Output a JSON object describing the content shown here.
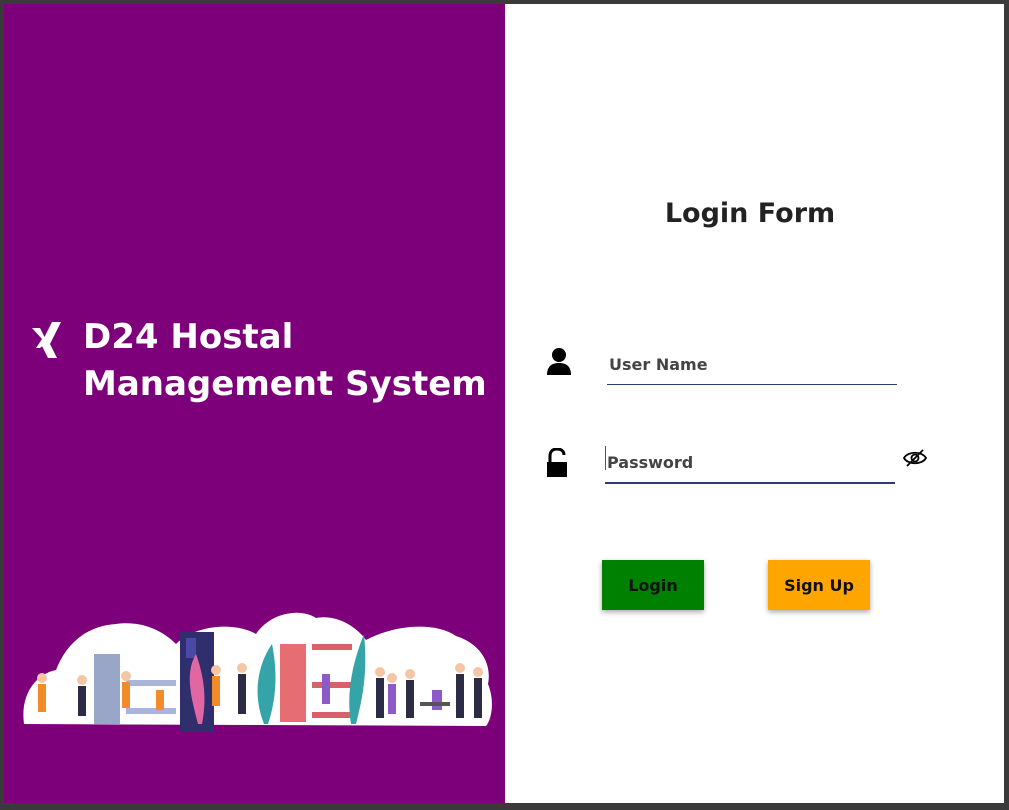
{
  "brand": {
    "logo_icon": "xing-icon",
    "title_line1": "D24 Hostal",
    "title_line2": "Management System",
    "panel_color": "#7d007a"
  },
  "form": {
    "title": "Login Form",
    "username_placeholder": "User Name",
    "username_icon": "user-icon",
    "password_placeholder": "Password",
    "password_icon": "lock-open-icon",
    "toggle_icon": "eye-slash-icon"
  },
  "buttons": {
    "login_label": "Login",
    "login_color": "#008000",
    "signup_label": "Sign Up",
    "signup_color": "#ffa500"
  }
}
